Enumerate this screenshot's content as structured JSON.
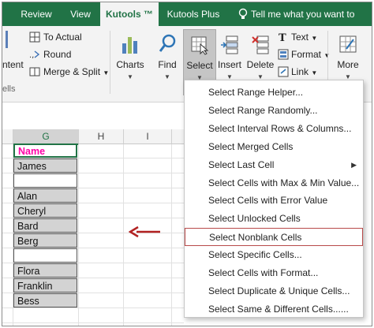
{
  "tabs": [
    {
      "label": "Review",
      "active": false
    },
    {
      "label": "View",
      "active": false
    },
    {
      "label": "Kutools ™",
      "active": true
    },
    {
      "label": "Kutools Plus",
      "active": false
    }
  ],
  "tell_me": {
    "label": "Tell me what you want to do..."
  },
  "ribbon": {
    "left_clipped": {
      "content_label": "ntent",
      "group_label": "ells"
    },
    "to_actual": "To Actual",
    "round": "Round",
    "merge_split": "Merge & Split",
    "buttons": {
      "charts": "Charts",
      "find": "Find",
      "select": "Select",
      "insert": "Insert",
      "delete": "Delete",
      "more": "More"
    },
    "text": "Text",
    "format": "Format",
    "link": "Link"
  },
  "sheet": {
    "columns": [
      "G",
      "H",
      "I"
    ],
    "cells": [
      "Name",
      "James",
      "",
      "Alan",
      "Cheryl",
      "Bard",
      "Berg",
      "",
      "Flora",
      "Franklin",
      "Bess"
    ]
  },
  "menu": {
    "items": [
      {
        "label": "Select Range Helper..."
      },
      {
        "label": "Select Range Randomly..."
      },
      {
        "label": "Select Interval Rows & Columns..."
      },
      {
        "label": "Select Merged Cells"
      },
      {
        "label": "Select Last Cell",
        "submenu": true
      },
      {
        "label": "Select Cells with Max & Min Value..."
      },
      {
        "label": "Select Cells with Error Value"
      },
      {
        "label": "Select Unlocked Cells"
      },
      {
        "label": "Select Nonblank Cells",
        "highlighted": true
      },
      {
        "label": "Select Specific Cells..."
      },
      {
        "label": "Select Cells with Format..."
      },
      {
        "label": "Select Duplicate & Unique Cells..."
      },
      {
        "label": "Select Same & Different Cells......"
      }
    ]
  },
  "colors": {
    "excel_green": "#217346",
    "name_header": "#ff00a8",
    "highlight_border": "#b84a4a",
    "arrow": "#b22222"
  }
}
